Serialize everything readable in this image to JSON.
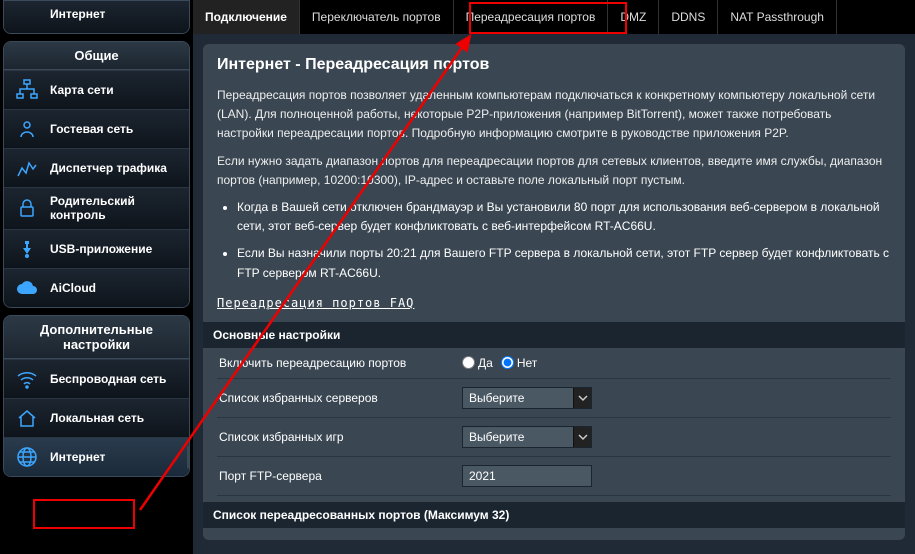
{
  "sidebar": {
    "top_partial": "Интернет",
    "groups": [
      {
        "title": "Общие",
        "items": [
          {
            "label": "Карта сети",
            "name": "sidebar-item-network-map",
            "icon": "network"
          },
          {
            "label": "Гостевая сеть",
            "name": "sidebar-item-guest-network",
            "icon": "guest"
          },
          {
            "label": "Диспетчер трафика",
            "name": "sidebar-item-traffic-manager",
            "icon": "traffic"
          },
          {
            "label": "Родительский контроль",
            "name": "sidebar-item-parental-control",
            "icon": "lock"
          },
          {
            "label": "USB-приложение",
            "name": "sidebar-item-usb-app",
            "icon": "usb"
          },
          {
            "label": "AiCloud",
            "name": "sidebar-item-aicloud",
            "icon": "cloud"
          }
        ]
      },
      {
        "title": "Дополнительные настройки",
        "items": [
          {
            "label": "Беспроводная сеть",
            "name": "sidebar-item-wireless",
            "icon": "wifi"
          },
          {
            "label": "Локальная сеть",
            "name": "sidebar-item-lan",
            "icon": "house"
          },
          {
            "label": "Интернет",
            "name": "sidebar-item-internet",
            "icon": "globe",
            "active": true
          }
        ]
      }
    ]
  },
  "tabs": [
    {
      "label": "Подключение",
      "active": true
    },
    {
      "label": "Переключатель портов"
    },
    {
      "label": "Переадресация портов",
      "highlighted": true
    },
    {
      "label": "DMZ"
    },
    {
      "label": "DDNS"
    },
    {
      "label": "NAT Passthrough"
    }
  ],
  "page": {
    "title": "Интернет - Переадресация портов",
    "desc1": "Переадресация портов позволяет удаленным компьютерам подключаться к конкретному компьютеру локальной сети (LAN). Для полноценной работы, некоторые P2P-приложения (например BitTorrent), может также потребовать настройки переадресации портов. Подробную информацию смотрите в руководстве приложения P2P.",
    "desc2": "Если нужно задать диапазон портов для переадресации портов для сетевых клиентов, введите имя службы, диапазон портов (например, 10200:10300), IP-адрес и оставьте поле локальный порт пустым.",
    "note1": "Когда в Вашей сети отключен брандмауэр и Вы установили 80 порт для использования веб-сервером в локальной сети, этот веб-сервер будет конфликтовать с веб-интерфейсом RT-AC66U.",
    "note2": "Если Вы назначили порты 20:21 для Вашего FTP сервера в локальной сети, этот FTP сервер будет конфликтовать с FTP сервером RT-AC66U.",
    "faq": "Переадресация портов FAQ",
    "section_basic": "Основные настройки",
    "section_list": "Список переадресованных портов (Максимум 32)",
    "rows": {
      "enable": {
        "label": "Включить переадресацию портов",
        "yes": "Да",
        "no": "Нет"
      },
      "servers": {
        "label": "Список избранных серверов",
        "value": "Выберите"
      },
      "games": {
        "label": "Список избранных игр",
        "value": "Выберите"
      },
      "ftp": {
        "label": "Порт FTP-сервера",
        "value": "2021"
      }
    }
  }
}
